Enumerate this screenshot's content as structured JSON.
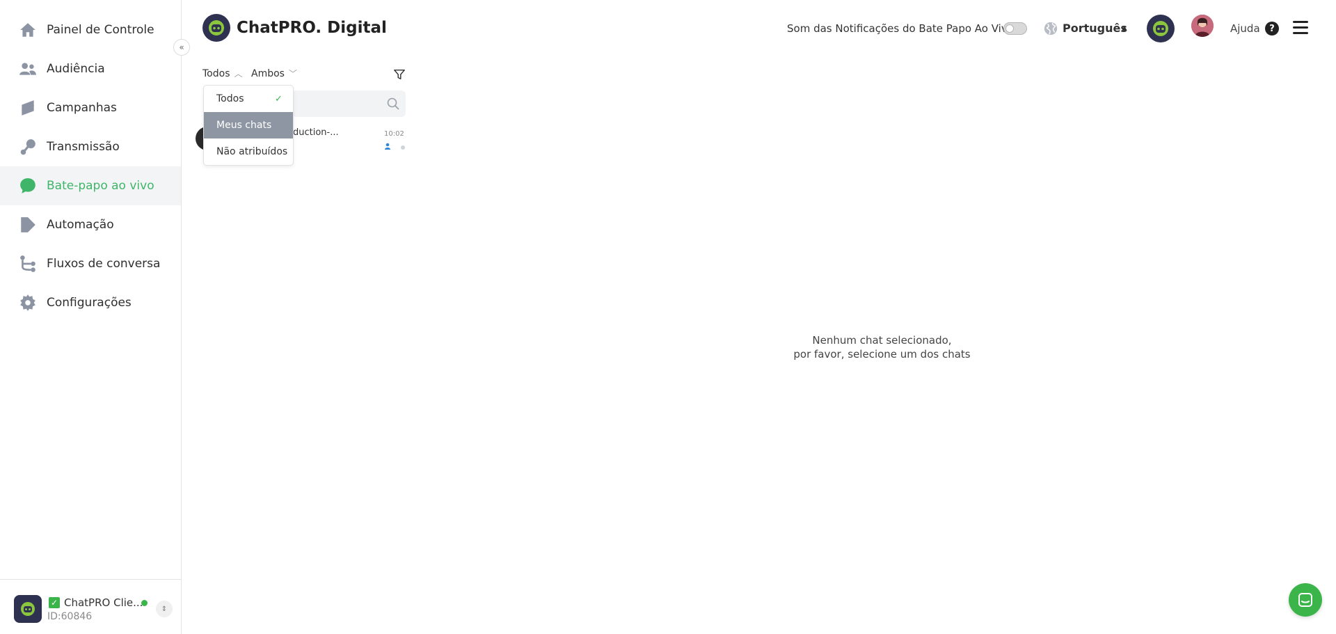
{
  "sidebar": {
    "items": [
      {
        "label": "Painel de Controle",
        "icon": "home-icon"
      },
      {
        "label": "Audiência",
        "icon": "users-icon"
      },
      {
        "label": "Campanhas",
        "icon": "campaign-icon"
      },
      {
        "label": "Transmissão",
        "icon": "broadcast-icon"
      },
      {
        "label": "Bate-papo ao vivo",
        "icon": "chat-bubble-icon",
        "active": true
      },
      {
        "label": "Automação",
        "icon": "automation-icon"
      },
      {
        "label": "Fluxos de conversa",
        "icon": "flow-icon"
      },
      {
        "label": "Configurações",
        "icon": "gear-icon"
      }
    ],
    "account": {
      "name": "ChatPRO Clie...",
      "id": "ID:60846"
    }
  },
  "header": {
    "brand_title": "ChatPRO. Digital",
    "sound_label": "Som das Notificações do Bate Papo Ao Vivo",
    "language": "Português",
    "help_label": "Ajuda"
  },
  "chat_list": {
    "filter_assign": "Todos",
    "filter_channel": "Ambos",
    "dropdown": {
      "items": [
        {
          "label": "Todos",
          "selected": true
        },
        {
          "label": "Meus chats",
          "hover": true
        },
        {
          "label": "Não atribuídos"
        }
      ]
    },
    "rows": [
      {
        "name": "duction-...",
        "time": "10:02"
      }
    ]
  },
  "main": {
    "empty_line1": "Nenhum chat selecionado,",
    "empty_line2": "por favor, selecione um dos chats"
  },
  "colors": {
    "accent": "#3fb56a",
    "status_online": "#3bb54a",
    "dropdown_hover": "#8d96a2"
  }
}
